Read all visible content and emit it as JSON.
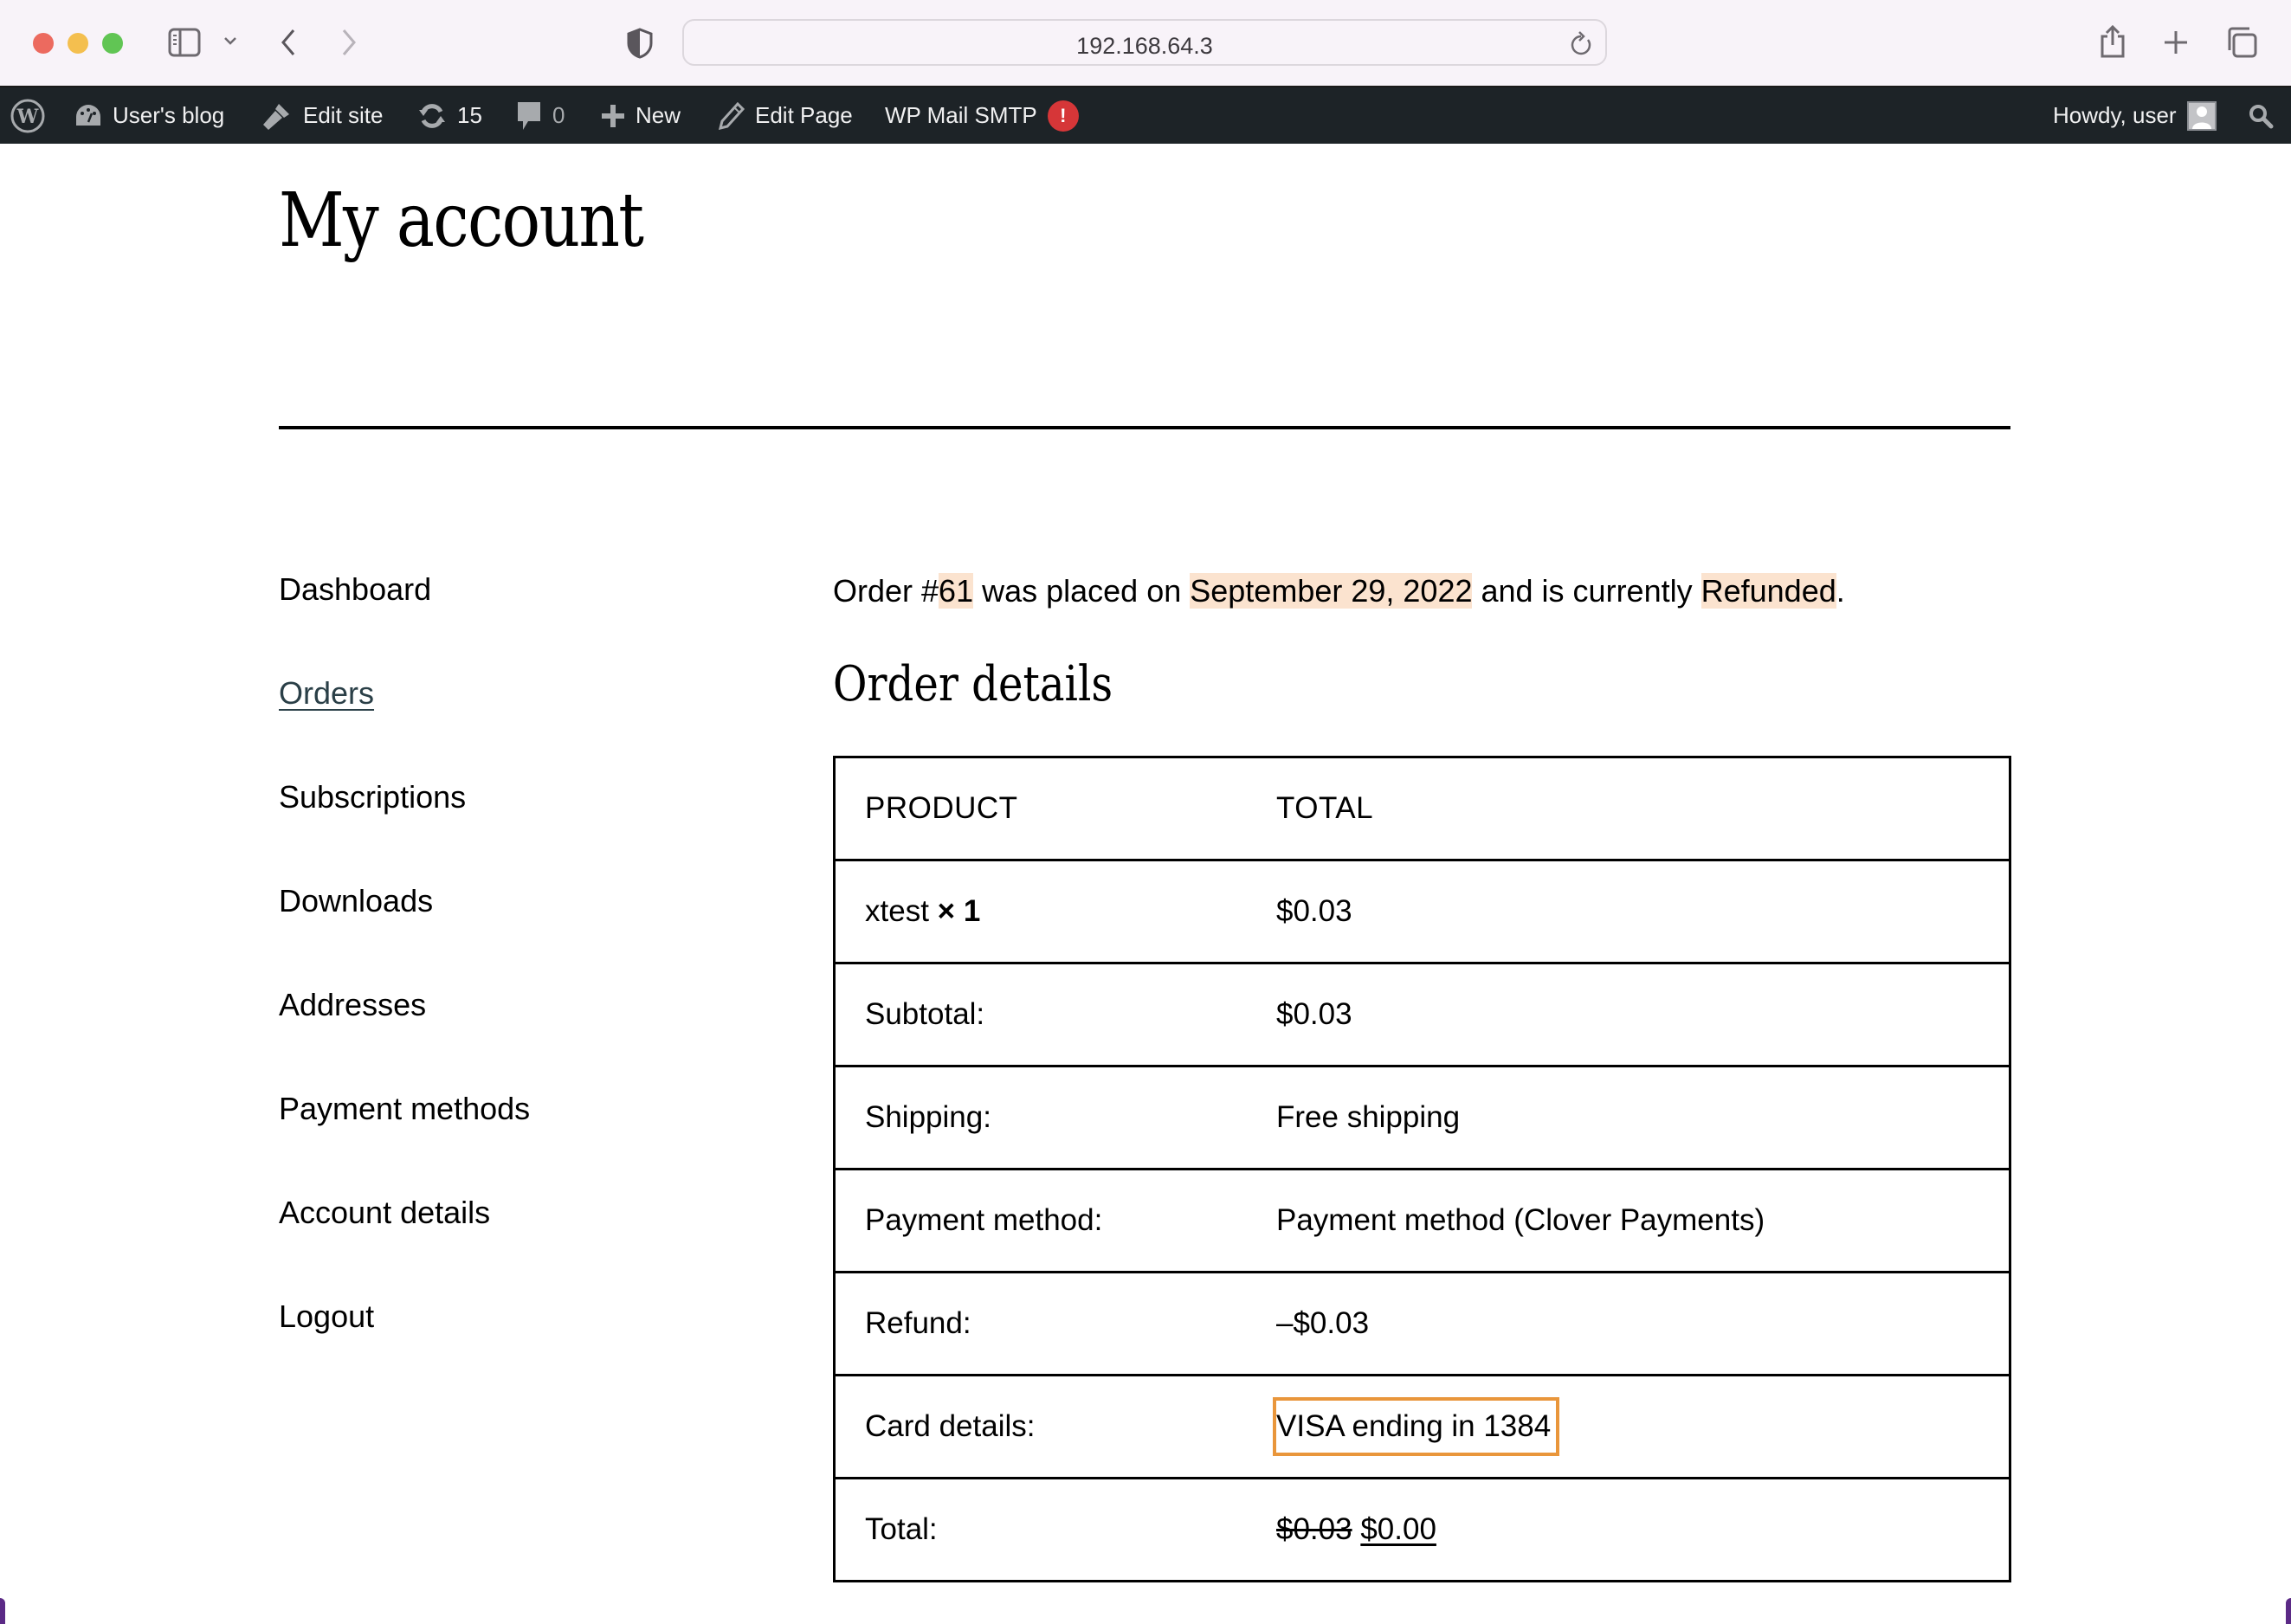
{
  "browser": {
    "url": "192.168.64.3",
    "icons": {
      "close": "traffic-light-red",
      "minimize": "traffic-light-yellow",
      "zoom": "traffic-light-green",
      "sidebar": "sidebar-icon",
      "sidebar_menu": "chevron-down-icon",
      "back": "chevron-left-icon",
      "forward": "chevron-right-icon",
      "privacy": "shield-icon",
      "reload": "reload-icon",
      "share": "share-icon",
      "new_tab": "plus-icon",
      "tabs": "tabs-overview-icon"
    }
  },
  "adminbar": {
    "site_name": "User's blog",
    "edit_site": "Edit site",
    "updates_count": "15",
    "comments_count": "0",
    "new_label": "New",
    "edit_page": "Edit Page",
    "wp_mail_smtp": "WP Mail SMTP",
    "smtp_badge": "!",
    "howdy": "Howdy, user"
  },
  "page": {
    "title": "My account"
  },
  "nav": {
    "items": [
      {
        "label": "Dashboard",
        "active": false
      },
      {
        "label": "Orders",
        "active": true
      },
      {
        "label": "Subscriptions",
        "active": false
      },
      {
        "label": "Downloads",
        "active": false
      },
      {
        "label": "Addresses",
        "active": false
      },
      {
        "label": "Payment methods",
        "active": false
      },
      {
        "label": "Account details",
        "active": false
      },
      {
        "label": "Logout",
        "active": false
      }
    ]
  },
  "order": {
    "prefix": "Order #",
    "number": "61",
    "placed_on_text": " was placed on ",
    "date": "September 29, 2022",
    "status_text": " and is currently ",
    "status": "Refunded",
    "suffix": ".",
    "details_title": "Order details",
    "table": {
      "headers": [
        "PRODUCT",
        "TOTAL"
      ],
      "product": {
        "name": "xtest",
        "qty": "× 1",
        "total": "$0.03"
      },
      "rows": [
        {
          "label": "Subtotal:",
          "value": "$0.03"
        },
        {
          "label": "Shipping:",
          "value": "Free shipping"
        },
        {
          "label": "Payment method:",
          "value": "Payment method (Clover Payments)"
        },
        {
          "label": "Refund:",
          "value": "–$0.03"
        },
        {
          "label": "Card details:",
          "value": "VISA ending in 1384"
        }
      ],
      "total": {
        "label": "Total:",
        "original": "$0.03",
        "current": "$0.00"
      }
    },
    "colors": {
      "highlight": "#fbe3cf",
      "focus_box": "#e9963b"
    }
  }
}
